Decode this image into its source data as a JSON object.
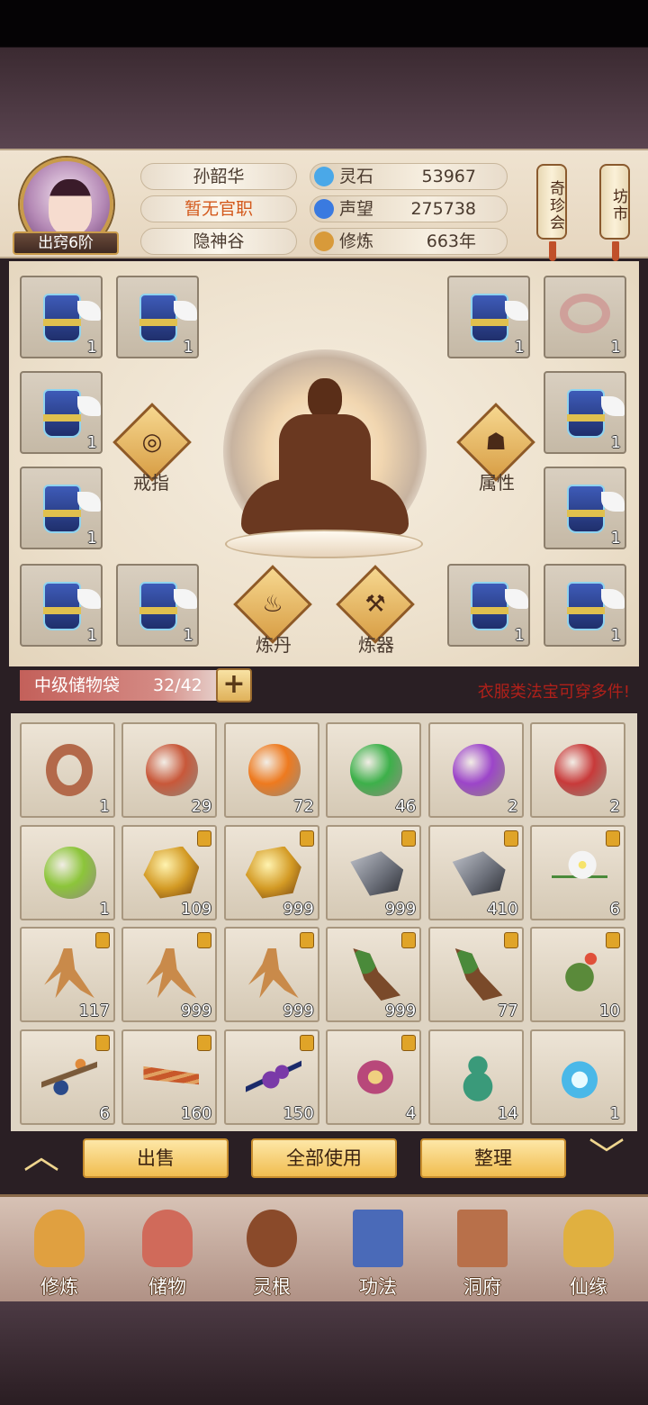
{
  "player": {
    "name": "孙韶华",
    "title": "暂无官职",
    "sect": "隐神谷",
    "rank": "出窍6阶"
  },
  "resources": [
    {
      "name": "灵石",
      "value": "53967",
      "icon": "spirit-stone-icon",
      "color": "#4aa8e8"
    },
    {
      "name": "声望",
      "value": "275738",
      "icon": "reputation-icon",
      "color": "#3a7ae0"
    },
    {
      "name": "修炼",
      "value": "663年",
      "icon": "cultivation-icon",
      "color": "#d89a3a"
    }
  ],
  "side_buttons": {
    "treasure": "奇珍会",
    "market": "坊市"
  },
  "equipment": {
    "slots_left": [
      "1",
      "1",
      "1",
      "1",
      "1",
      "1"
    ],
    "slots_right": [
      "1",
      "1",
      "1",
      "1",
      "1",
      "1"
    ],
    "ring_btn": "戒指",
    "attr_btn": "属性",
    "alchemy_btn": "炼丹",
    "forge_btn": "炼器"
  },
  "bag": {
    "title": "中级储物袋",
    "capacity": "32/42",
    "add": "+",
    "tip": "衣服类法宝可穿多件!"
  },
  "items": [
    {
      "kind": "ring",
      "count": "1",
      "locked": false,
      "color": "#b3694a"
    },
    {
      "kind": "orb",
      "count": "29",
      "locked": false,
      "color": "#c8583a"
    },
    {
      "kind": "orb",
      "count": "72",
      "locked": false,
      "color": "#ee7a1f"
    },
    {
      "kind": "orb",
      "count": "46",
      "locked": false,
      "color": "#3db04a"
    },
    {
      "kind": "orb",
      "count": "2",
      "locked": false,
      "color": "#9c45c9"
    },
    {
      "kind": "orb",
      "count": "2",
      "locked": false,
      "color": "#c83a3a"
    },
    {
      "kind": "orb",
      "count": "1",
      "locked": false,
      "color": "#8cc53a"
    },
    {
      "kind": "ore",
      "count": "109",
      "locked": true,
      "color": "#d39a24"
    },
    {
      "kind": "ore",
      "count": "999",
      "locked": true,
      "color": "#d39a24"
    },
    {
      "kind": "iron",
      "count": "999",
      "locked": true,
      "color": "#6a6e78"
    },
    {
      "kind": "iron",
      "count": "410",
      "locked": true,
      "color": "#6a6e78"
    },
    {
      "kind": "flower",
      "count": "6",
      "locked": true,
      "color": "#f4f4f4"
    },
    {
      "kind": "ginseng",
      "count": "117",
      "locked": true,
      "color": "#c98a4a"
    },
    {
      "kind": "ginseng",
      "count": "999",
      "locked": true,
      "color": "#c98a4a"
    },
    {
      "kind": "ginseng",
      "count": "999",
      "locked": true,
      "color": "#c98a4a"
    },
    {
      "kind": "root",
      "count": "999",
      "locked": true,
      "color": "#7a4a2a"
    },
    {
      "kind": "root",
      "count": "77",
      "locked": true,
      "color": "#7a4a2a"
    },
    {
      "kind": "herb",
      "count": "10",
      "locked": true,
      "color": "#5a8a3a"
    },
    {
      "kind": "branch",
      "count": "6",
      "locked": true,
      "color": "#2a4a8a"
    },
    {
      "kind": "worm",
      "count": "160",
      "locked": true,
      "color": "#c8582a"
    },
    {
      "kind": "berry",
      "count": "150",
      "locked": true,
      "color": "#7a3aa8"
    },
    {
      "kind": "lantern",
      "count": "4",
      "locked": true,
      "color": "#b8487a"
    },
    {
      "kind": "gourd",
      "count": "14",
      "locked": false,
      "color": "#3a9a7a"
    },
    {
      "kind": "bowl",
      "count": "1",
      "locked": false,
      "color": "#4ab8e8"
    }
  ],
  "actions": {
    "sell": "出售",
    "use_all": "全部使用",
    "sort": "整理"
  },
  "nav": [
    {
      "label": "修炼",
      "icon": "cultivate-icon",
      "color": "#e0a040"
    },
    {
      "label": "储物",
      "icon": "storage-bag-icon",
      "color": "#d06a5a"
    },
    {
      "label": "灵根",
      "icon": "spirit-root-icon",
      "color": "#8a4a2a"
    },
    {
      "label": "功法",
      "icon": "technique-book-icon",
      "color": "#4a6ab8"
    },
    {
      "label": "洞府",
      "icon": "cave-house-icon",
      "color": "#b8704a"
    },
    {
      "label": "仙缘",
      "icon": "immortal-gourd-icon",
      "color": "#e0b040"
    }
  ]
}
